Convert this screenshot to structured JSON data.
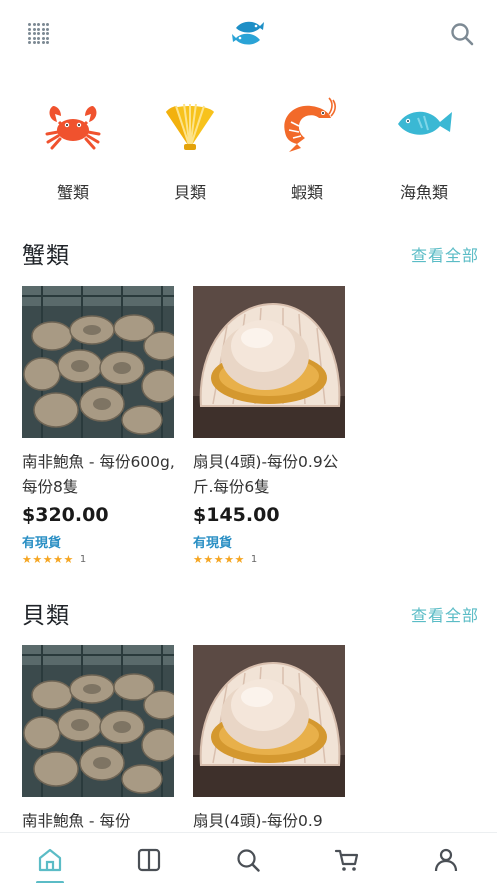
{
  "header": {
    "menu_icon": "grid-dots-icon",
    "logo_icon": "fish-logo-icon",
    "search_icon": "search-icon"
  },
  "categories": [
    {
      "label": "蟹類",
      "icon": "crab-icon",
      "color": "#f0522e"
    },
    {
      "label": "貝類",
      "icon": "shell-icon",
      "color": "#f7c21c"
    },
    {
      "label": "蝦類",
      "icon": "shrimp-icon",
      "color": "#f26a2a"
    },
    {
      "label": "海魚類",
      "icon": "fish-icon",
      "color": "#3ab8d4"
    }
  ],
  "sections": [
    {
      "title": "蟹類",
      "see_all": "查看全部",
      "products": [
        {
          "name": "南非鮑魚 - 每份600g,每份8隻",
          "price": "$320.00",
          "stock": "有現貨",
          "stars": "★★★★★",
          "rating_count": "1",
          "image": "abalone-photo"
        },
        {
          "name": "扇貝(4頭)-每份0.9公斤.每份6隻",
          "price": "$145.00",
          "stock": "有現貨",
          "stars": "★★★★★",
          "rating_count": "1",
          "image": "scallop-photo"
        }
      ]
    },
    {
      "title": "貝類",
      "see_all": "查看全部",
      "products": [
        {
          "name": "南非鮑魚 - 每份",
          "image": "abalone-photo"
        },
        {
          "name": "扇貝(4頭)-每份0.9",
          "image": "scallop-photo"
        }
      ]
    }
  ],
  "bottom_nav": [
    {
      "icon": "home-icon",
      "active": true
    },
    {
      "icon": "catalog-icon",
      "active": false
    },
    {
      "icon": "search-icon",
      "active": false
    },
    {
      "icon": "cart-icon",
      "active": false
    },
    {
      "icon": "account-icon",
      "active": false
    }
  ],
  "colors": {
    "accent": "#5bbcc6",
    "stock": "#2a8fc4",
    "star": "#f5a623"
  }
}
